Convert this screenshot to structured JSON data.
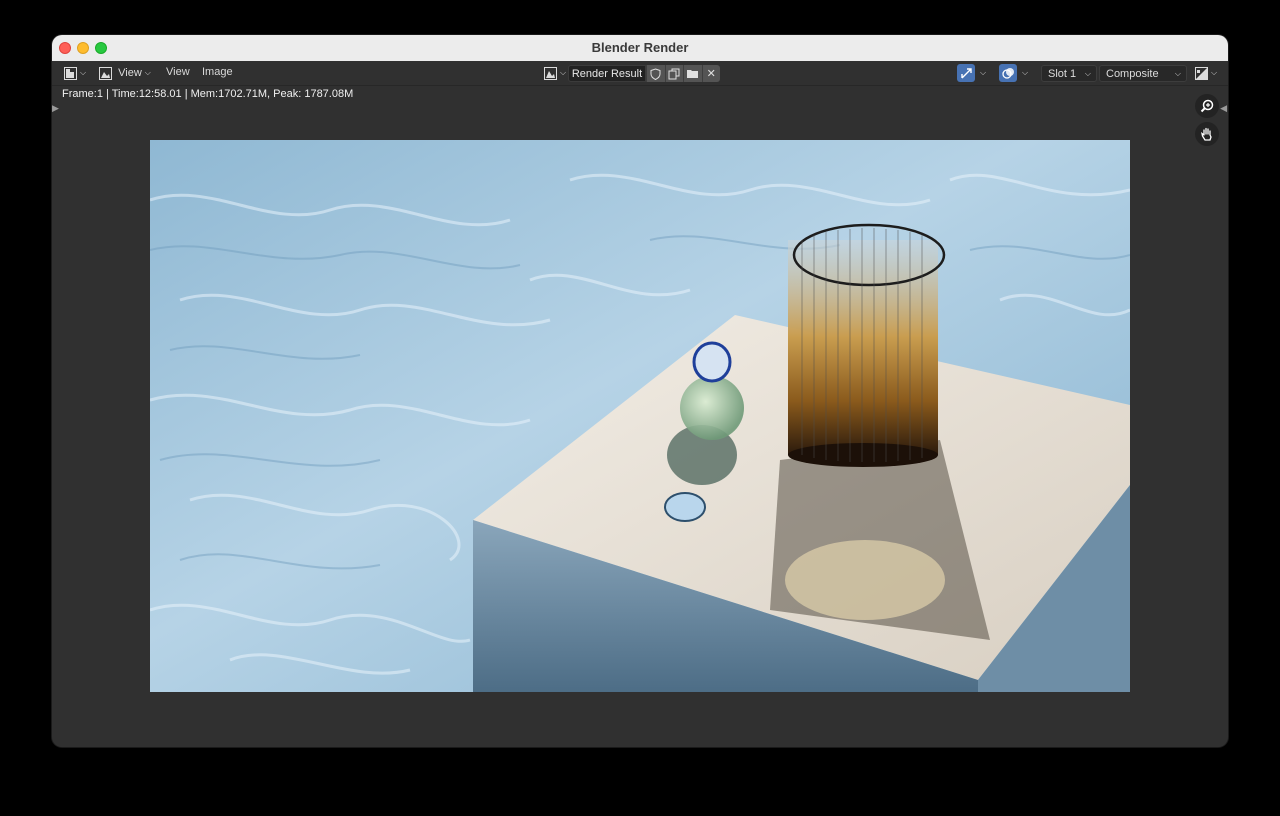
{
  "window": {
    "title": "Blender Render"
  },
  "header": {
    "editor_type_icon": "image-editor-icon",
    "view_label": "View",
    "menus": [
      "View",
      "Image"
    ],
    "image_name": "Render Result",
    "slot": "Slot 1",
    "layer": "Composite"
  },
  "info": {
    "text": "Frame:1 | Time:12:58.01 | Mem:1702.71M, Peak: 1787.08M"
  },
  "colors": {
    "accent": "#4772b3",
    "background": "#303030",
    "header": "#303030",
    "titlebar": "#ececec"
  },
  "tools": [
    "zoom-icon",
    "hand-icon"
  ]
}
